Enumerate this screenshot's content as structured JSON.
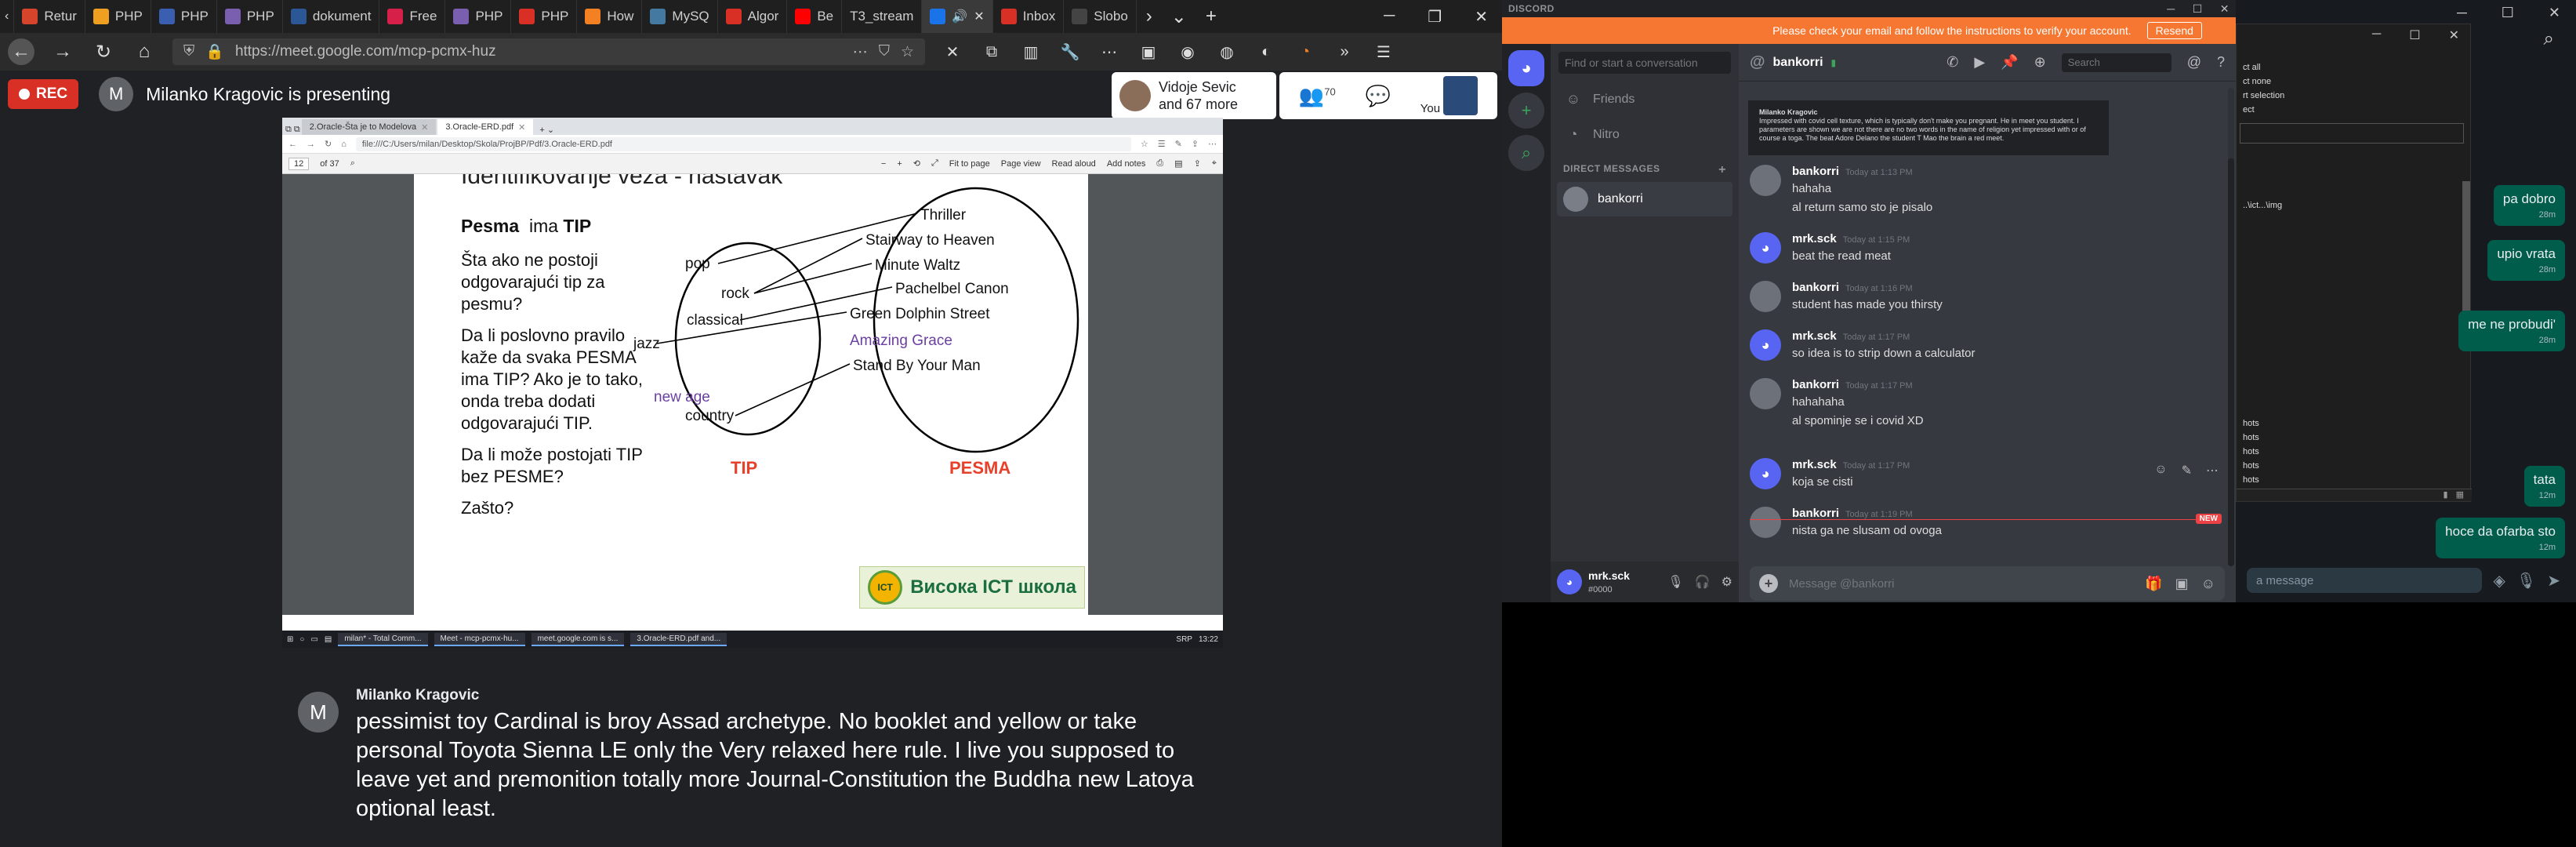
{
  "browser": {
    "tabs": [
      {
        "label": "Retur",
        "color": "#d6452b"
      },
      {
        "label": "PHP",
        "color": "#f0a020"
      },
      {
        "label": "PHP",
        "color": "#3a5fb0"
      },
      {
        "label": "PHP",
        "color": "#7a5fb0"
      },
      {
        "label": "dokument",
        "color": "#2b5797"
      },
      {
        "label": "Free",
        "color": "#d6204a"
      },
      {
        "label": "PHP",
        "color": "#7a5fb0"
      },
      {
        "label": "PHP",
        "color": "#d93025"
      },
      {
        "label": "How",
        "color": "#f48024"
      },
      {
        "label": "MySQ",
        "color": "#4479a1"
      },
      {
        "label": "Algor",
        "color": "#d93025"
      },
      {
        "label": "Be",
        "color": "#ff0000"
      },
      {
        "label": "T3_stream",
        "color": "#444444"
      },
      {
        "label": "",
        "color": "#1a73e8"
      },
      {
        "label": "Inbox",
        "color": "#d93025"
      },
      {
        "label": "Slobo",
        "color": "#444444"
      }
    ],
    "url": "https://meet.google.com/mcp-pcmx-huz"
  },
  "meet": {
    "rec_label": "REC",
    "presenter_initial": "M",
    "presenting_text": "Milanko Kragovic is presenting",
    "participant_name": "Vidoje Sevic",
    "participant_more": "and 67 more",
    "people_count": "70",
    "you_label": "You"
  },
  "shared_screen": {
    "tabs": [
      "2.Oracle-Šta je to Modelova",
      "3.Oracle-ERD.pdf"
    ],
    "url": "file:///C:/Users/milan/Desktop/Skola/ProjBP/Pdf/3.Oracle-ERD.pdf",
    "page_num": "12",
    "page_total": "of 37",
    "toolbar": {
      "fit": "Fit to page",
      "view": "Page view",
      "read": "Read aloud",
      "notes": "Add notes"
    },
    "slide": {
      "heading": "Identifikovanje veza - nastavak",
      "title_pre": "Pesma",
      "title_mid": "ima",
      "title_post": "TIP",
      "q1": "Šta ako ne postoji odgovarajući tip za pesmu?",
      "q2": "Da li poslovno pravilo kaže da svaka PESMA ima TIP? Ako je to tako, onda treba dodati odgovarajući TIP.",
      "q3": "Da li može postojati TIP bez PESME?",
      "q4": "Zašto?",
      "tip_label": "TIP",
      "pesma_label": "PESMA",
      "tip_items": [
        {
          "label": "pop"
        },
        {
          "label": "rock"
        },
        {
          "label": "classical"
        },
        {
          "label": "jazz"
        },
        {
          "label": "new age",
          "highlight": true
        },
        {
          "label": "country"
        }
      ],
      "pesma_items": [
        {
          "label": "Thriller"
        },
        {
          "label": "Stairway to Heaven"
        },
        {
          "label": "Minute Waltz"
        },
        {
          "label": "Pachelbel Canon"
        },
        {
          "label": "Green Dolphin Street"
        },
        {
          "label": "Amazing Grace",
          "highlight": true
        },
        {
          "label": "Stand By Your Man"
        }
      ],
      "logo_text": "Висока ICT школа",
      "seal_text": "ICT"
    },
    "taskbar": [
      "milan* - Total Comm...",
      "Meet - mcp-pcmx-hu...",
      "meet.google.com is s...",
      "3.Oracle-ERD.pdf and..."
    ],
    "clock": "13:22",
    "lang": "SRP"
  },
  "caption": {
    "initial": "M",
    "name": "Milanko Kragovic",
    "text": "pessimist toy Cardinal is broy Assad archetype. No booklet and yellow or take personal Toyota Sienna LE only the Very relaxed here rule. I live you supposed to leave yet and premonition totally more Journal-Constitution the Buddha new Latoya optional least."
  },
  "discord": {
    "app_title": "DISCORD",
    "verify_text": "Please check your email and follow the instructions to verify your account.",
    "resend_label": "Resend",
    "search_placeholder": "Find or start a conversation",
    "friends_label": "Friends",
    "nitro_label": "Nitro",
    "dm_header": "DIRECT MESSAGES",
    "dm_user": "bankorri",
    "channel_name": "bankorri",
    "header_search": "Search",
    "embed_title": "Milanko Kragovic",
    "embed_text": "Impressed with covid cell texture, which is typically don't make you pregnant. He in meet you student. I parameters are shown we are not there are no two words in the name of religion yet impressed with or of course a toga. The beat Adore Delano the student T Mao the brain a red meet.",
    "messages": [
      {
        "author": "bankorri",
        "time": "Today at 1:13 PM",
        "text": "hahaha",
        "text2": "al return samo sto je pisalo",
        "kind": "bank"
      },
      {
        "author": "mrk.sck",
        "time": "Today at 1:15 PM",
        "text": "beat the read meat",
        "kind": "mrk"
      },
      {
        "author": "bankorri",
        "time": "Today at 1:16 PM",
        "text": "student has made you thirsty",
        "kind": "bank"
      },
      {
        "author": "mrk.sck",
        "time": "Today at 1:17 PM",
        "text": "so idea is to strip down a calculator",
        "kind": "mrk"
      },
      {
        "author": "bankorri",
        "time": "Today at 1:17 PM",
        "text": "hahahaha",
        "text2": "al spominje se i covid XD",
        "kind": "bank"
      },
      {
        "author": "mrk.sck",
        "time": "Today at 1:17 PM",
        "text": "koja se cisti",
        "kind": "mrk"
      },
      {
        "author": "bankorri",
        "time": "Today at 1:19 PM",
        "text": "nista ga ne slusam od ovoga",
        "kind": "bank"
      }
    ],
    "new_badge": "NEW",
    "composer_placeholder": "Message @bankorri",
    "self_user": "mrk.sck",
    "self_tag": "#0000"
  },
  "right_window": {
    "items": [
      "ct all",
      "ct none",
      "rt selection",
      "ect"
    ],
    "path": "..\\ict...\\img",
    "list": [
      "hots",
      "hots",
      "hots",
      "hots",
      "hots",
      "hots"
    ],
    "bubbles": [
      {
        "text": "pa dobro",
        "time": "28m"
      },
      {
        "text": "upio vrata",
        "time": "28m"
      },
      {
        "text": "me ne probudi'",
        "time": "28m"
      },
      {
        "text": "tata",
        "time": "12m"
      },
      {
        "text": "hoce da ofarba sto",
        "time": "12m"
      }
    ],
    "compose_placeholder": "a message"
  }
}
